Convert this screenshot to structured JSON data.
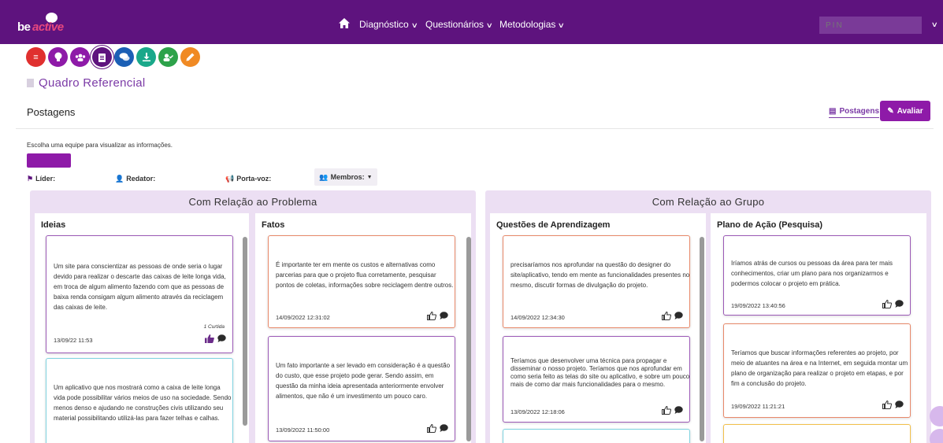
{
  "navbar": {
    "logo_be": "be",
    "logo_active": "active",
    "menu": [
      {
        "label": "Diagnóstico"
      },
      {
        "label": "Questionários"
      },
      {
        "label": "Metodologias"
      }
    ],
    "pin_placeholder": "PIN"
  },
  "tools": [
    {
      "icon": "menu-icon",
      "color": "#e0302f",
      "glyph": "≡"
    },
    {
      "icon": "lightbulb-icon",
      "color": "#8e1aa8",
      "glyph": "●"
    },
    {
      "icon": "group-icon",
      "color": "#8e1aa8",
      "glyph": "☷"
    },
    {
      "icon": "clipboard-icon",
      "color": "#5e137e",
      "glyph": "▤"
    },
    {
      "icon": "chat-icon",
      "color": "#1b5fb5",
      "glyph": "●"
    },
    {
      "icon": "download-icon",
      "color": "#1aa88a",
      "glyph": "⤓"
    },
    {
      "icon": "user-check-icon",
      "color": "#2da24a",
      "glyph": "●"
    },
    {
      "icon": "pencil-icon",
      "color": "#f08a24",
      "glyph": "✎"
    }
  ],
  "page": {
    "title": "Quadro Referencial",
    "section": "Postagens",
    "btn_postagens": "Postagens",
    "btn_avaliar": "Avaliar",
    "choose_team": "Escolha uma equipe para visualizar as informações.",
    "roles": {
      "lider": "Líder:",
      "redator": "Redator:",
      "porta_voz": "Porta-voz:",
      "membros": "Membros:"
    }
  },
  "boards": {
    "problema": {
      "title": "Com Relação ao Problema"
    },
    "grupo": {
      "title": "Com Relação ao Grupo"
    }
  },
  "columns": {
    "ideias": {
      "title": "Ideias",
      "cards": [
        {
          "text": "Um site para conscientizar as pessoas de onde seria o lugar devido para realizar o descarte das caixas de leite longa vida, em troca de algum alimento fazendo com que as pessoas de baixa renda consigam algum alimento através da reciclagem das caixas de leite.",
          "likes": "1 Curtida",
          "date": "13/09/22 11:53",
          "color": "#9b59b6"
        },
        {
          "text": "Um aplicativo que nos mostrará como a caixa de leite longa vida pode possibilitar vários meios de uso na sociedade. Sendo menos denso e ajudando ne construções civis utilizando seu material possibilitando utilizá-las para fazer telhas e calhas.",
          "date": "",
          "color": "#7fd3e0"
        }
      ]
    },
    "fatos": {
      "title": "Fatos",
      "cards": [
        {
          "text": "É importante ter em mente os custos e alternativas como parcerias para que o projeto flua corretamente, pesquisar pontos de coletas, informações sobre reciclagem dentre outros.",
          "date": "14/09/2022 12:31:02",
          "color": "#e8896a"
        },
        {
          "text": "Um fato importante a ser levado em consideração é a questão do custo, que esse projeto pode gerar. Sendo assim, em questão da minha ideia apresentada anteriormente envolver alimentos, que não é um investimento um pouco caro.",
          "date": "13/09/2022 11:50:00",
          "color": "#9b59b6"
        }
      ]
    },
    "questoes": {
      "title": "Questões de Aprendizagem",
      "cards": [
        {
          "text": "precisaríamos nos aprofundar na questão do designer do site/aplicativo, tendo em mente as funcionalidades presentes no mesmo, discutir formas de divulgação do projeto.",
          "date": "14/09/2022 12:34:30",
          "color": "#e8896a"
        },
        {
          "text": "Teríamos que desenvolver uma técnica para propagar e disseminar o nosso projeto. Teríamos que nos aprofundar em como seria feito as telas do site ou aplicativo, e sobre um pouco mais de como dar mais funcionalidades para o mesmo.",
          "date": "13/09/2022 12:18:06",
          "color": "#9b59b6"
        },
        {
          "text": "",
          "date": "",
          "color": "#7fd3e0"
        }
      ]
    },
    "plano": {
      "title": "Plano de Ação (Pesquisa)",
      "cards": [
        {
          "text": "Iríamos atrás de cursos ou pessoas da área para ter mais conhecimentos, criar um plano para nos organizarmos e podermos colocar o projeto em prática.",
          "date": "19/09/2022 13:40:56",
          "color": "#9b59b6"
        },
        {
          "text": "Teríamos que buscar informações referentes ao projeto, por meio de atuantes na área e na Internet, em seguida montar um plano de organização para realizar o projeto em etapas, e por fim a conclusão do projeto.",
          "date": "19/09/2022 11:21:21",
          "color": "#e8896a"
        },
        {
          "text": "",
          "date": "",
          "color": "#f2c04b"
        }
      ]
    }
  },
  "colors": {
    "nav": "#5e137e",
    "accent": "#8e1aa8",
    "board_bg": "#ecdff3"
  }
}
